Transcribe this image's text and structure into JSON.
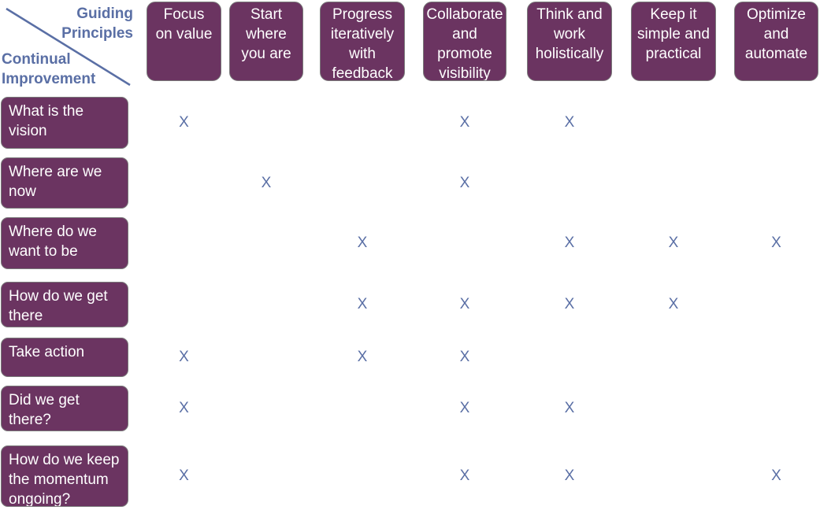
{
  "corner": {
    "column_axis_label": "Guiding Principles",
    "row_axis_label": "Continual Improvement"
  },
  "columns": [
    {
      "label": "Focus\non value"
    },
    {
      "label": "Start\nwhere\nyou are"
    },
    {
      "label": "Progress\niteratively\nwith\nfeedback"
    },
    {
      "label": "Collaborate\nand\npromote\nvisibility"
    },
    {
      "label": "Think and\nwork\nholistically"
    },
    {
      "label": "Keep it\nsimple and\npractical"
    },
    {
      "label": "Optimize\nand\nautomate"
    }
  ],
  "rows": [
    {
      "label": "What is the\nvision",
      "marks": [
        true,
        false,
        false,
        true,
        true,
        false,
        false
      ]
    },
    {
      "label": "Where are we\nnow",
      "marks": [
        false,
        true,
        false,
        true,
        false,
        false,
        false
      ]
    },
    {
      "label": "Where do we\nwant to be",
      "marks": [
        false,
        false,
        true,
        false,
        true,
        true,
        true
      ]
    },
    {
      "label": "How do we get\nthere",
      "marks": [
        false,
        false,
        true,
        true,
        true,
        true,
        false
      ]
    },
    {
      "label": "Take action",
      "marks": [
        true,
        false,
        true,
        true,
        false,
        false,
        false
      ]
    },
    {
      "label": "Did we get\nthere?",
      "marks": [
        true,
        false,
        false,
        true,
        true,
        false,
        false
      ]
    },
    {
      "label": "How do we keep\nthe momentum\nongoing?",
      "marks": [
        true,
        false,
        false,
        true,
        true,
        false,
        true
      ]
    }
  ],
  "mark_symbol": "X",
  "colors": {
    "box_fill": "#6b3461",
    "accent_text": "#5a6fa5"
  }
}
